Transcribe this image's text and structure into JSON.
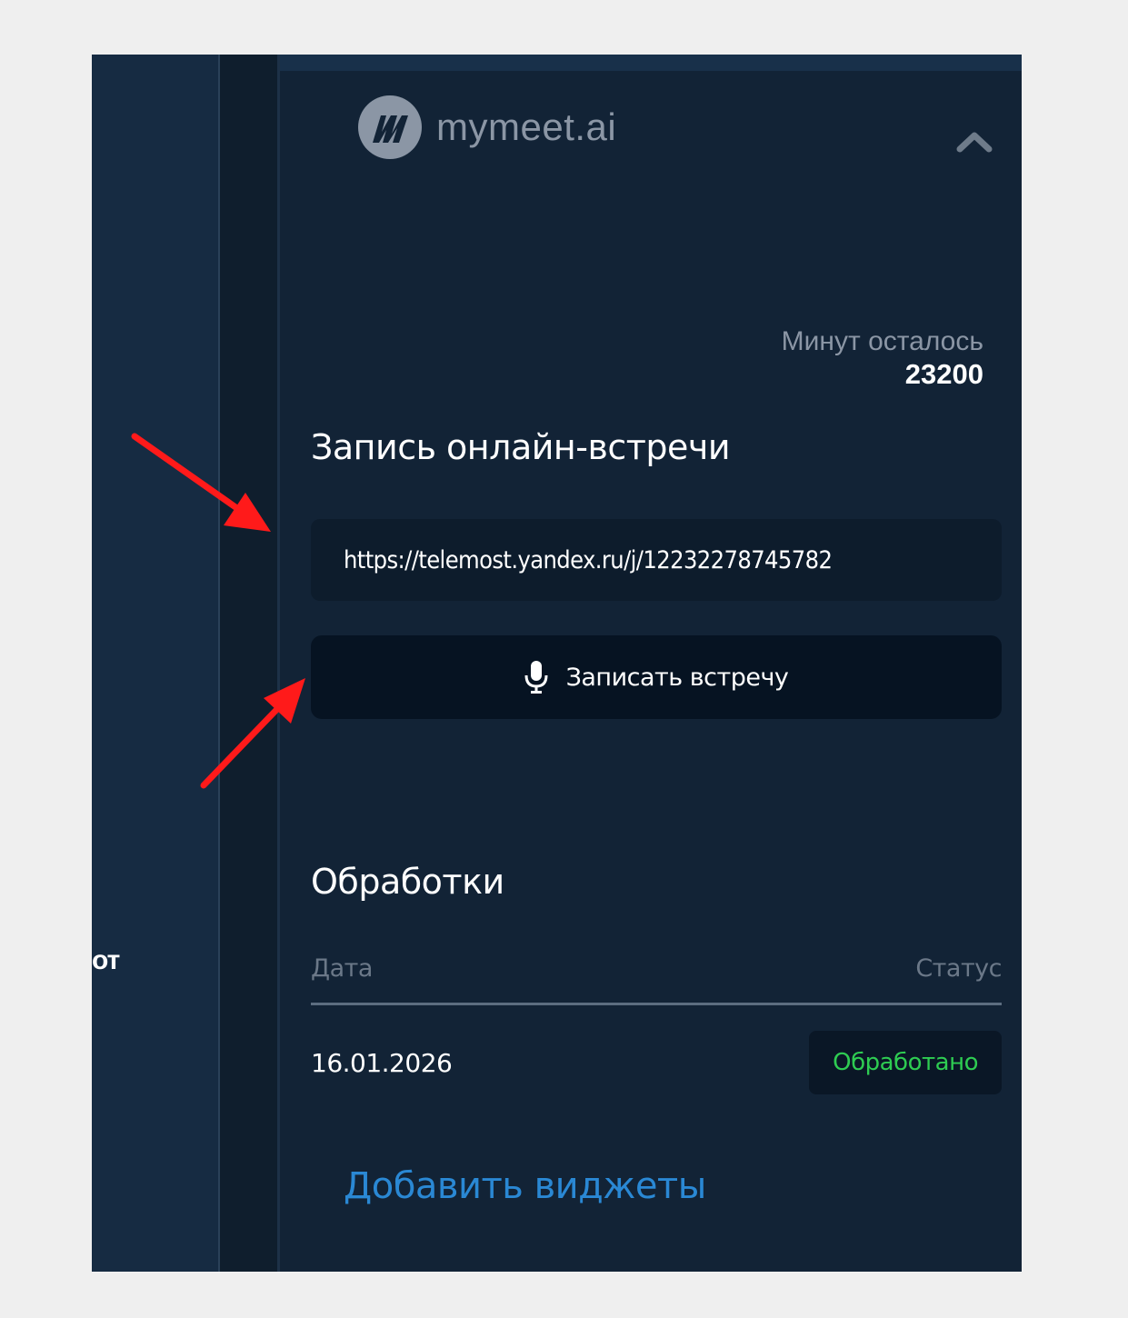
{
  "left_pane": {
    "partial_text": "от"
  },
  "header": {
    "logo_text": "mymeet.ai",
    "collapse_icon": "chevron-up-icon"
  },
  "minutes": {
    "label": "Минут осталось",
    "value": "23200"
  },
  "recording": {
    "title": "Запись онлайн-встречи",
    "url_value": "https://telemost.yandex.ru/j/12232278745782",
    "button_label": "Записать встречу",
    "button_icon": "microphone-icon"
  },
  "processing": {
    "title": "Обработки",
    "columns": {
      "date": "Дата",
      "status": "Статус"
    },
    "rows": [
      {
        "date": "16.01.2026",
        "status": "Обработано"
      }
    ]
  },
  "add_widgets_label": "Добавить виджеты",
  "colors": {
    "panel_bg": "#122336",
    "status_ok": "#2ecc52",
    "link": "#2a88d4",
    "annotation_arrow": "#ff1a1a"
  }
}
